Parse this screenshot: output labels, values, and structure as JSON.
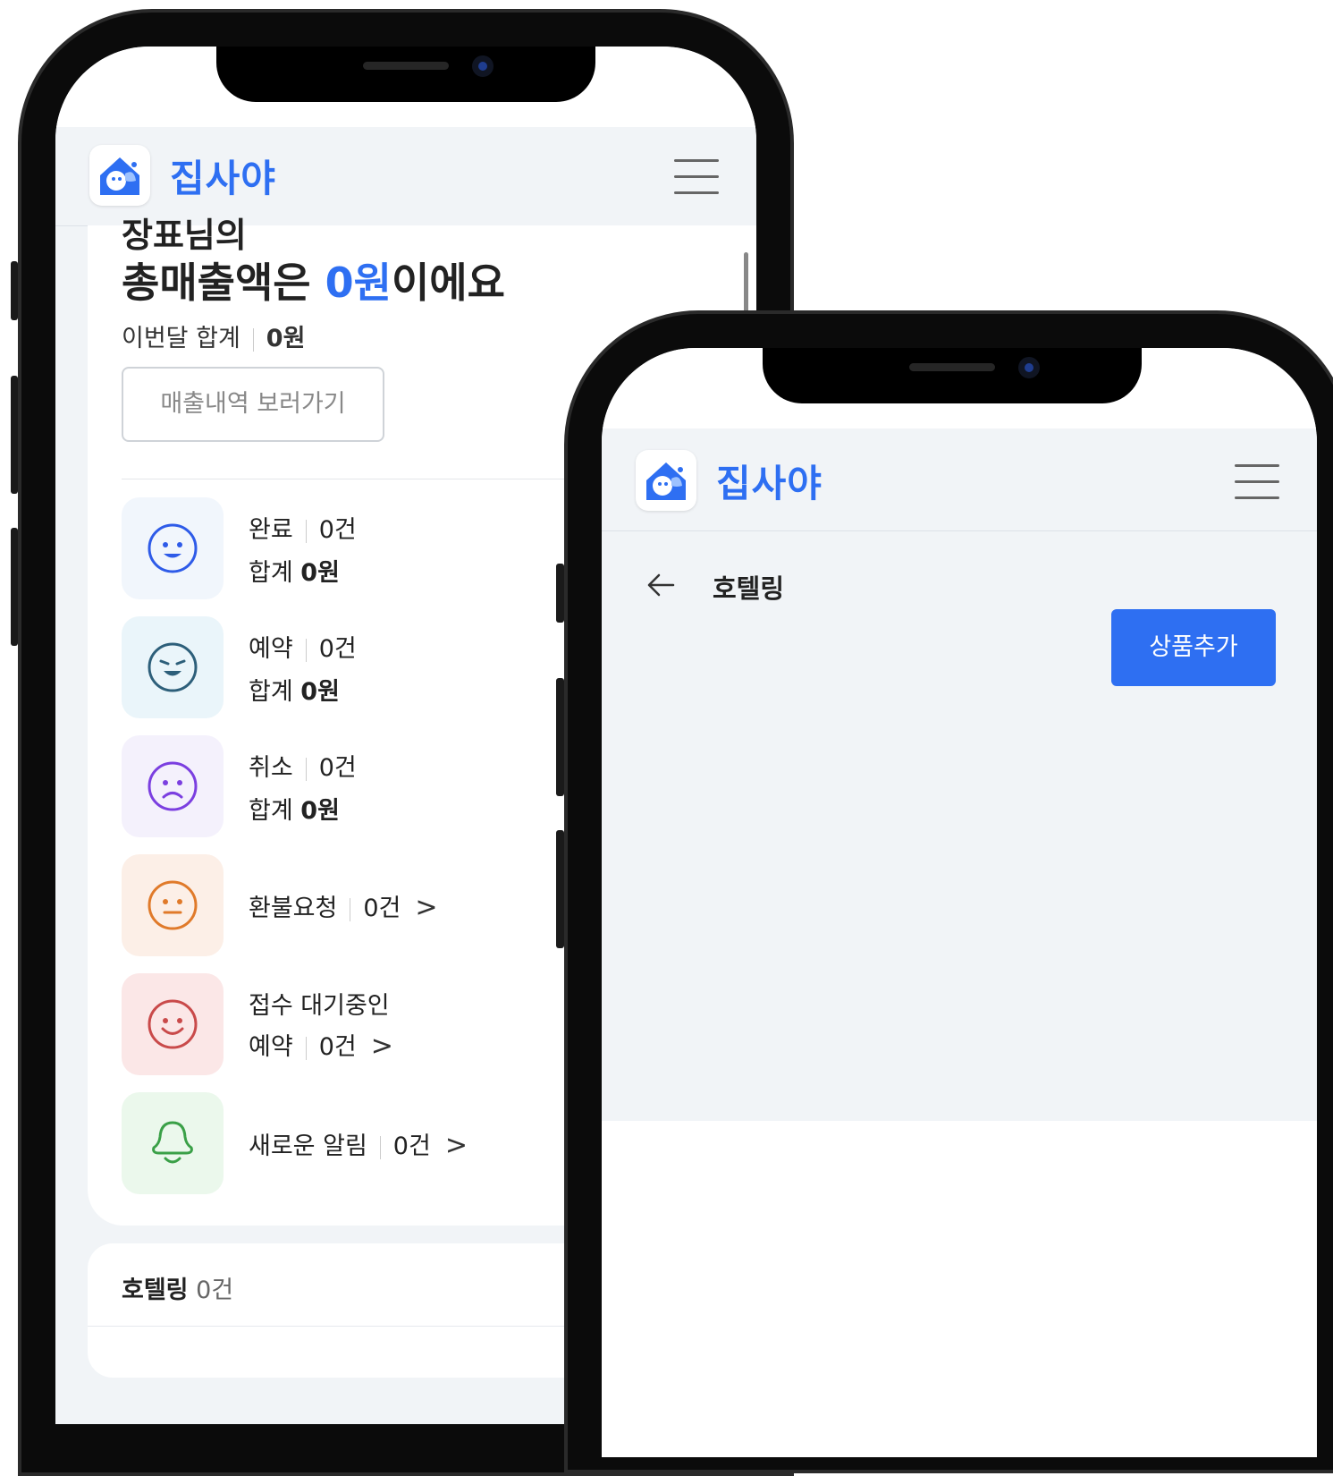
{
  "brand": {
    "name": "집사야",
    "accent": "#2e6ff2"
  },
  "dashboard": {
    "partial_line": "장표님의",
    "headline_prefix": "총매출액은 ",
    "headline_amount": "0원",
    "headline_suffix": "이에요",
    "month_label": "이번달 합계",
    "month_value": "0원",
    "history_button": "매출내역 보러가기",
    "items": [
      {
        "label": "완료",
        "count": "0건",
        "total_label": "합계",
        "total": "0원",
        "icon": "smile-face-icon",
        "bg": "#f1f6fc",
        "color": "#2e5be8"
      },
      {
        "label": "예약",
        "count": "0건",
        "total_label": "합계",
        "total": "0원",
        "icon": "grin-face-icon",
        "bg": "#eaf5fa",
        "color": "#2d5f7a"
      },
      {
        "label": "취소",
        "count": "0건",
        "total_label": "합계",
        "total": "0원",
        "icon": "sad-face-icon",
        "bg": "#f4f1fc",
        "color": "#7b3fe0"
      },
      {
        "label": "환불요청",
        "count": "0건",
        "icon": "neutral-face-icon",
        "bg": "#fcefe7",
        "color": "#e07a2a"
      },
      {
        "label": "접수 대기중인",
        "sublabel": "예약",
        "count": "0건",
        "icon": "happy-face-icon",
        "bg": "#fbe7e7",
        "color": "#c94a4a"
      },
      {
        "label": "새로운 알림",
        "count": "0건",
        "icon": "bell-icon",
        "bg": "#ebf8ec",
        "color": "#3aa047"
      }
    ],
    "hotel_section": {
      "label": "호텔링",
      "count": "0건"
    }
  },
  "detail": {
    "title": "호텔링",
    "add_button": "상품추가"
  }
}
